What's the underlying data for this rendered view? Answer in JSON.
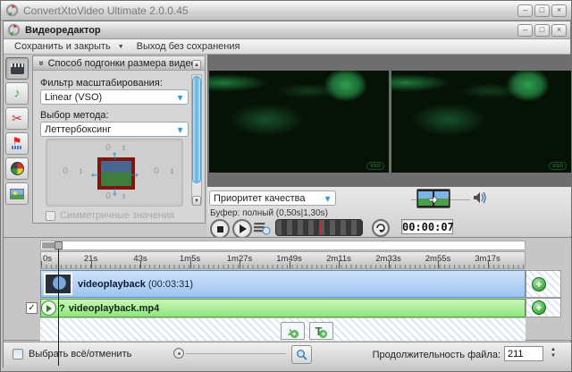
{
  "window": {
    "title": "ConvertXtoVideo Ultimate 2.0.0.45",
    "controls": {
      "minimize": "–",
      "maximize": "□",
      "close": "×"
    }
  },
  "editor": {
    "title": "Видеоредактор"
  },
  "menu": {
    "save_close": "Сохранить и закрыть",
    "dropdown_arrow": "▼",
    "exit": "Выход без сохранения"
  },
  "panel": {
    "header_chevron": "»",
    "header": "Способ подгонки размера видео",
    "filter_label": "Фильтр масштабирования:",
    "filter_value": "Linear (VSO)",
    "method_label": "Выбор метода:",
    "method_value": "Леттербоксинг",
    "pad_top": "0",
    "pad_left": "0",
    "pad_right": "0",
    "pad_bottom": "0",
    "symmetric_label": "Симметричные значения"
  },
  "preview": {
    "watermark": "vso"
  },
  "controls": {
    "quality_value": "Приоритет качества",
    "buffer_text": "Буфер: полный (0,50s|1,30s)",
    "time": "00:00:07"
  },
  "timeline": {
    "ticks": [
      "0s",
      "21s",
      "43s",
      "1m5s",
      "1m27s",
      "1m49s",
      "2m11s",
      "2m33s",
      "2m55s",
      "3m17s"
    ],
    "video_track": {
      "name": "videoplayback",
      "duration": "(00:03:31)"
    },
    "audio_track": {
      "prefix": "?",
      "name": "videoplayback.mp4"
    }
  },
  "bottom": {
    "select_label": "Выбрать всё/отменить",
    "duration_label": "Продолжительность файла:",
    "duration_value": "211"
  },
  "icons": {
    "plus": "+",
    "music_note": "♪",
    "text_tool": "T",
    "scissors": "✂",
    "flag": "⚑",
    "check": "✓",
    "dropdown": "▼",
    "spin_up": "▲",
    "spin_down": "▼",
    "arrow_up": "↑",
    "arrow_down": "↓",
    "arrow_left": "←",
    "arrow_right": "→",
    "frame_arrow": "➜"
  }
}
